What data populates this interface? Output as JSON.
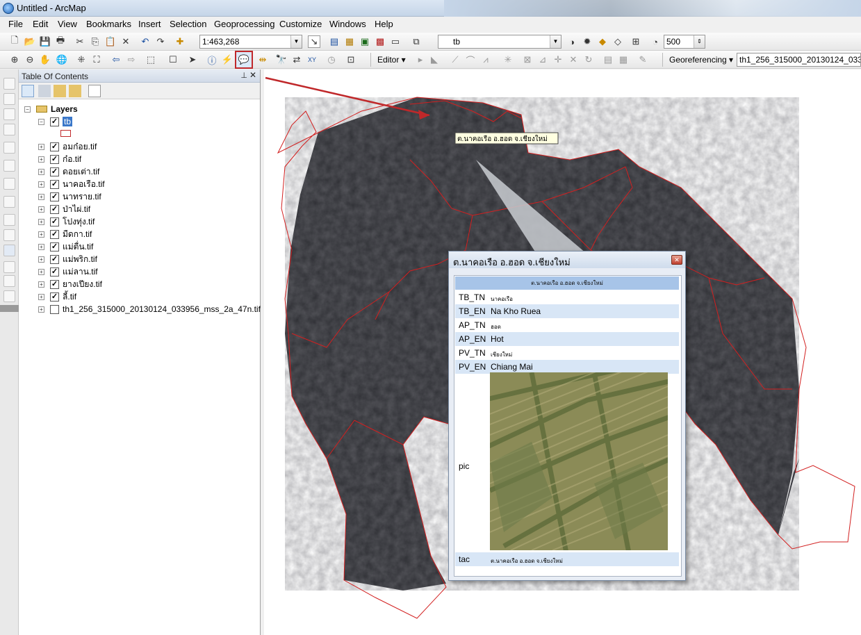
{
  "window": {
    "title": "Untitled - ArcMap"
  },
  "menu": [
    "File",
    "Edit",
    "View",
    "Bookmarks",
    "Insert",
    "Selection",
    "Geoprocessing",
    "Customize",
    "Windows",
    "Help"
  ],
  "toolbar1": {
    "scale_value": "1:463,268",
    "layer_combo": "tb",
    "number_value": "500"
  },
  "toolbar2": {
    "editor_label": "Editor ▾",
    "georef_label": "Georeferencing ▾",
    "georef_layer": "th1_256_315000_20130124_033"
  },
  "toc": {
    "title": "Table Of Contents",
    "root_label": "Layers",
    "selected_layer": "tb",
    "layers": [
      "อมก๋อย.tif",
      "ก๋อ.tif",
      "ดอยเต่า.tif",
      "นาคอเรือ.tif",
      "นาทราย.tif",
      "ป่าไผ่.tif",
      "โปงทุ่ง.tif",
      "มืดกา.tif",
      "แม่ตื่น.tif",
      "แม่พริก.tif",
      "แม่ลาน.tif",
      "ยางเปียง.tif",
      "ลี้.tif"
    ],
    "last_layer": "th1_256_315000_20130124_033956_mss_2a_47n.tif"
  },
  "tooltip": {
    "text": "ต.นาคอเรือ อ.ฮอด จ.เชียงใหม่"
  },
  "popup": {
    "title": "ต.นาคอเรือ อ.ฮอด จ.เชียงใหม่",
    "header": "ต.นาคอเรือ อ.ฮอด จ.เชียงใหม่",
    "rows": [
      {
        "key": "TB_TN",
        "value": "นาคอเรือ"
      },
      {
        "key": "TB_EN",
        "value": "Na Kho Ruea"
      },
      {
        "key": "AP_TN",
        "value": "ฮอด"
      },
      {
        "key": "AP_EN",
        "value": "Hot"
      },
      {
        "key": "PV_TN",
        "value": "เชียงใหม่"
      },
      {
        "key": "PV_EN",
        "value": "Chiang Mai"
      }
    ],
    "pic_label": "pic",
    "tac_key": "tac",
    "tac_value": "ต.นาคอเรือ อ.ฮอด จ.เชียงใหม่"
  },
  "colors": {
    "boundary": "#d21f1f",
    "imagery": "#2f2f33",
    "popup_header": "#a7c4e8",
    "row_alt": "#d8e6f6"
  }
}
